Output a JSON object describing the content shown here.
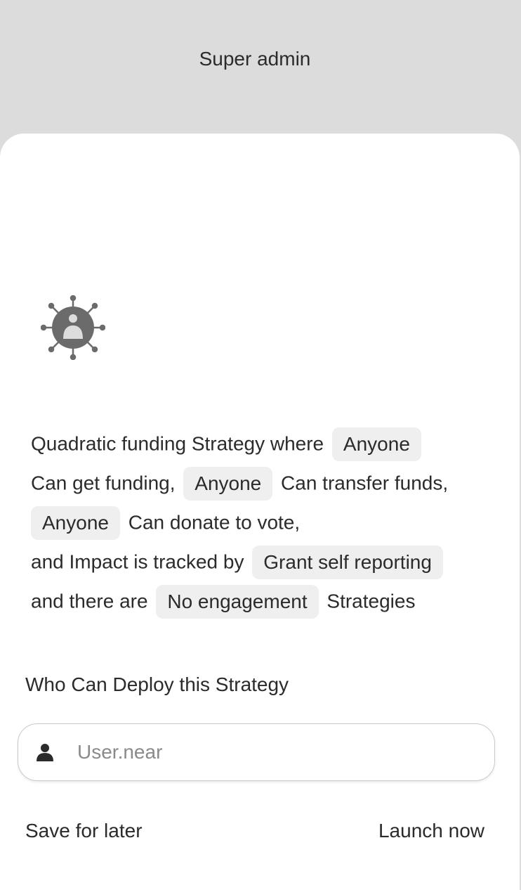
{
  "header": {
    "title": "Super admin"
  },
  "strategy": {
    "icon": "virus-person-icon",
    "line1": {
      "prefix": "Quadratic funding  Strategy where",
      "chip": "Anyone"
    },
    "line2": {
      "prefix": "Can get funding,",
      "chip": "Anyone",
      "suffix": "Can transfer funds,"
    },
    "line3": {
      "chip": "Anyone",
      "suffix": "Can donate to vote,"
    },
    "line4": {
      "prefix": "and Impact is tracked by",
      "chip": "Grant self reporting"
    },
    "line5": {
      "prefix": "and there are",
      "chip": "No engagement",
      "suffix": "Strategies"
    }
  },
  "deploy": {
    "heading": "Who Can Deploy this Strategy",
    "input_icon": "person-icon",
    "input_placeholder": "User.near",
    "input_value": ""
  },
  "actions": {
    "save_label": "Save for later",
    "launch_label": "Launch now"
  },
  "colors": {
    "background": "#dcdcdc",
    "sheet": "#ffffff",
    "chip": "#efefef",
    "text": "#2b2b2b",
    "icon": "#6b6b6b"
  }
}
